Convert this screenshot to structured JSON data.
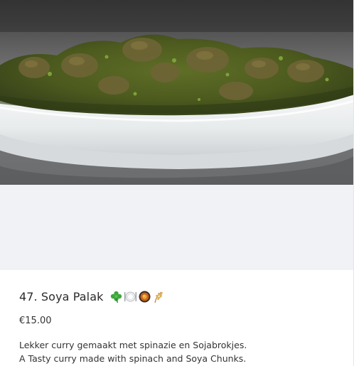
{
  "item": {
    "number_title": "47. Soya Palak",
    "price": "€15.00",
    "description_nl": "Lekker curry gemaakt met spinazie en Sojabrokjes.",
    "description_en": "A Tasty curry made with spinach and Soya Chunks.",
    "badges": [
      "clover-icon",
      "plate-icon",
      "curry-bowl-icon",
      "rice-icon"
    ]
  },
  "colors": {
    "placeholder_bg": "#f1f2f6",
    "curry_green": "#4f5e21",
    "plate_white": "#eef0f0"
  }
}
